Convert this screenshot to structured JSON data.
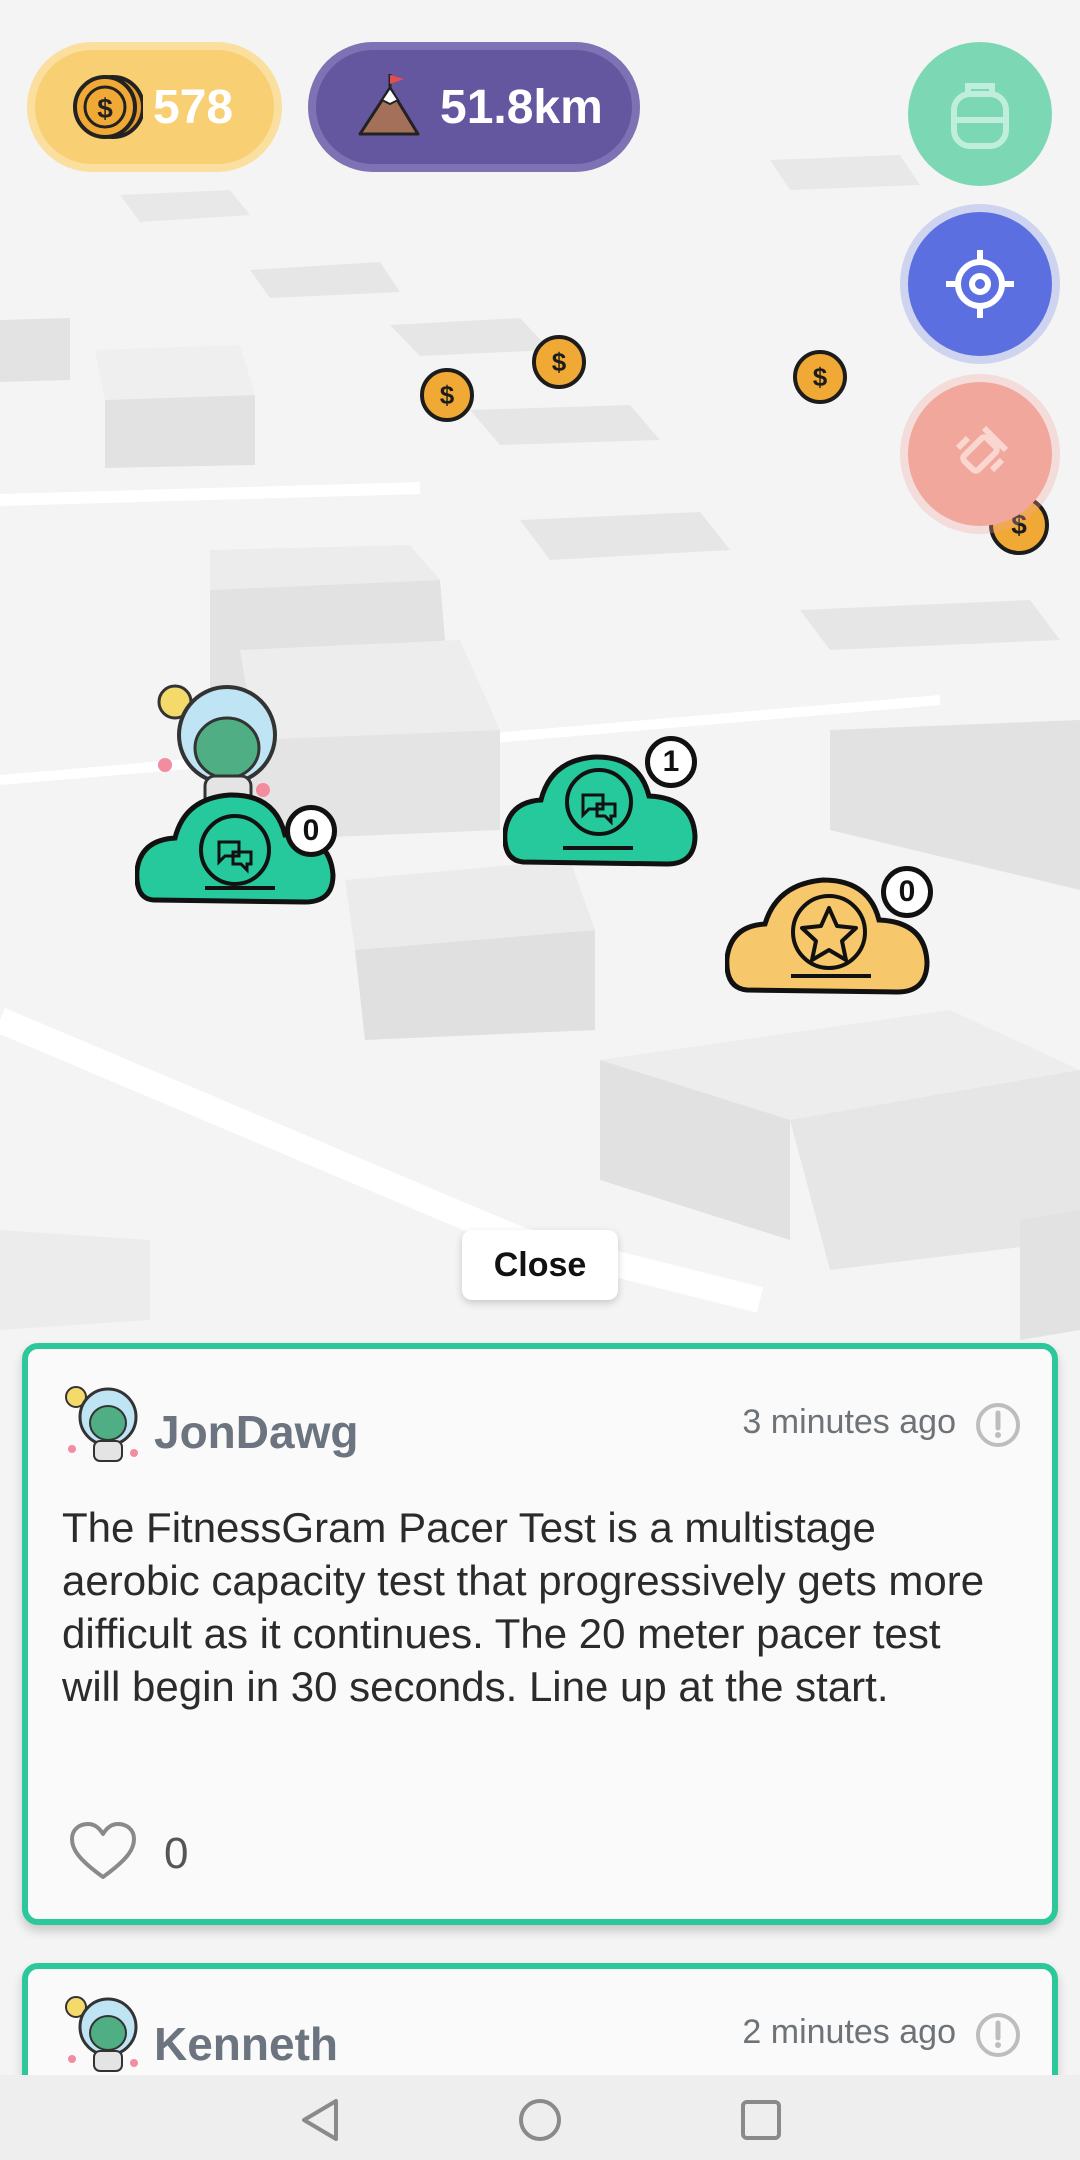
{
  "hud": {
    "coins": "578",
    "distance": "51.8km"
  },
  "map": {
    "clouds": [
      {
        "name": "cloud-chat-player",
        "count": "0",
        "icon": "chat-bubbles-icon",
        "color": "#26c99b"
      },
      {
        "name": "cloud-chat",
        "count": "1",
        "icon": "chat-bubbles-icon",
        "color": "#26c99b"
      },
      {
        "name": "cloud-star",
        "count": "0",
        "icon": "star-icon",
        "color": "#f6c86b"
      }
    ]
  },
  "close_label": "Close",
  "posts": [
    {
      "username": "JonDawg",
      "time": "3 minutes ago",
      "text": "The FitnessGram Pacer Test is a multistage aerobic capacity test that progressively gets more difficult as it continues. The 20 meter pacer test will begin in 30 seconds. Line up at the start.",
      "likes": "0"
    },
    {
      "username": "Kenneth",
      "time": "2 minutes ago"
    }
  ],
  "colors": {
    "teal": "#2cc79a",
    "gold": "#f8cf72",
    "purple": "#6556a0",
    "blue": "#5b6fe0",
    "salmon": "#f2a79c"
  }
}
